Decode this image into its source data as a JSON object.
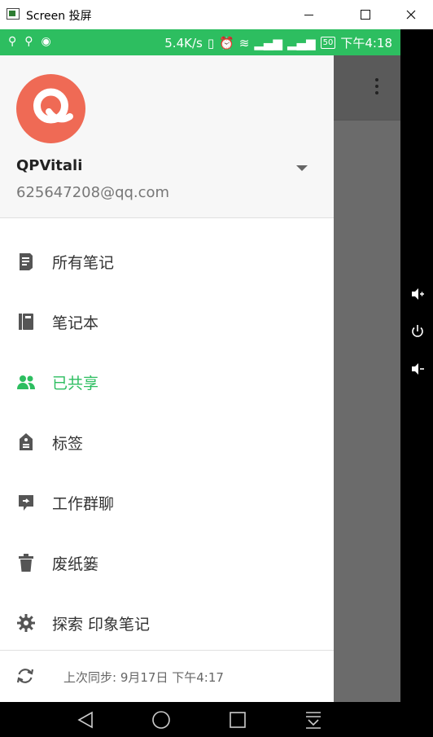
{
  "window": {
    "title": "Screen 投屏"
  },
  "status_bar": {
    "speed": "5.4K/s",
    "battery": "50",
    "time": "下午4:18"
  },
  "user": {
    "name": "QPVitali",
    "email": "625647208@qq.com"
  },
  "nav": {
    "items": [
      {
        "label": "所有笔记",
        "icon": "note-icon",
        "active": false
      },
      {
        "label": "笔记本",
        "icon": "notebook-icon",
        "active": false
      },
      {
        "label": "已共享",
        "icon": "shared-people-icon",
        "active": true
      },
      {
        "label": "标签",
        "icon": "tag-icon",
        "active": false
      },
      {
        "label": "工作群聊",
        "icon": "work-chat-icon",
        "active": false
      },
      {
        "label": "废纸篓",
        "icon": "trash-icon",
        "active": false
      },
      {
        "label": "探索 印象笔记",
        "icon": "gear-icon",
        "active": false
      }
    ]
  },
  "sync": {
    "text": "上次同步: 9月17日 下午4:17"
  },
  "colors": {
    "accent": "#2dbe60",
    "avatar": "#ef6a55",
    "overlay": "#6b6b6b"
  }
}
